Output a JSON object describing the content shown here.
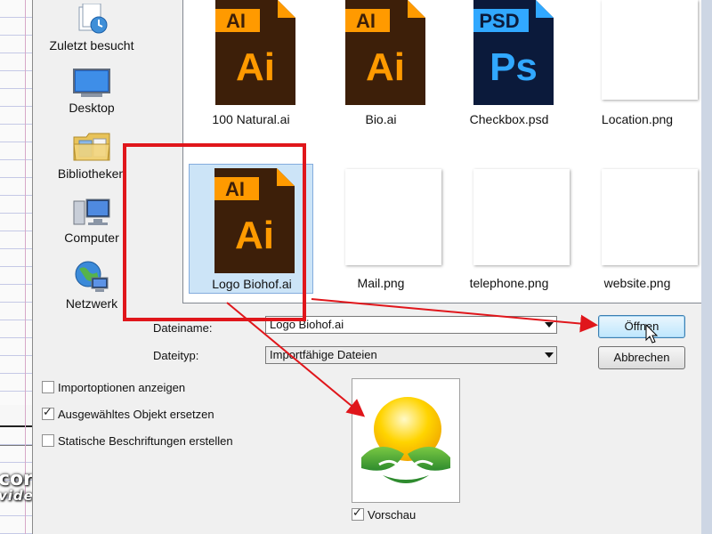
{
  "places": [
    {
      "label": "Zuletzt besucht",
      "icon": "recent-places-icon"
    },
    {
      "label": "Desktop",
      "icon": "desktop-icon"
    },
    {
      "label": "Bibliotheken",
      "icon": "libraries-icon"
    },
    {
      "label": "Computer",
      "icon": "computer-icon"
    },
    {
      "label": "Netzwerk",
      "icon": "network-icon"
    }
  ],
  "files": [
    {
      "name": "100 Natural.ai",
      "type": "ai"
    },
    {
      "name": "Bio.ai",
      "type": "ai"
    },
    {
      "name": "Checkbox.psd",
      "type": "psd"
    },
    {
      "name": "Location.png",
      "type": "png"
    },
    {
      "name": "Logo Biohof.ai",
      "type": "ai",
      "selected": true
    },
    {
      "name": "Mail.png",
      "type": "png"
    },
    {
      "name": "telephone.png",
      "type": "png"
    },
    {
      "name": "website.png",
      "type": "png"
    }
  ],
  "icon_text": {
    "ai_tab": "AI",
    "ai_big": "Ai",
    "psd_tab": "PSD",
    "psd_big": "Ps"
  },
  "form": {
    "filename_label": "Dateiname:",
    "filename_value": "Logo Biohof.ai",
    "filetype_label": "Dateityp:",
    "filetype_value": "Importfähige Dateien"
  },
  "buttons": {
    "open": "Öffnen",
    "cancel": "Abbrechen"
  },
  "options": [
    {
      "label": "Importoptionen anzeigen",
      "checked": false
    },
    {
      "label": "Ausgewähltes Objekt ersetzen",
      "checked": true
    },
    {
      "label": "Statische Beschriftungen erstellen",
      "checked": false
    }
  ],
  "preview": {
    "label": "Vorschau",
    "checked": true
  },
  "watermark": {
    "line1": "corials.de",
    "line2": "videointe"
  },
  "colors": {
    "ai_dark": "#3d1f09",
    "ai_orange": "#ff9a00",
    "psd_dark": "#0b1a3b",
    "psd_blue": "#31a8ff",
    "annotation_red": "#e0161b",
    "selection_blue": "#cce4f7"
  }
}
